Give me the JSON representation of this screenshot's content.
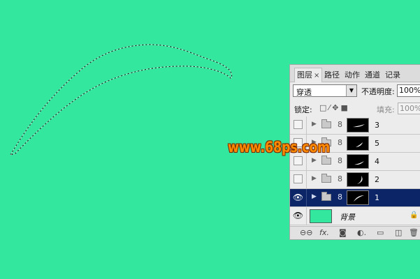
{
  "canvas": {
    "background_color": "#33e79e"
  },
  "watermark": {
    "text": "www.68ps.com",
    "color": "#ff8c00"
  },
  "panel": {
    "tabs": [
      {
        "label": "图层",
        "active": true,
        "close": "×"
      },
      {
        "label": "路径"
      },
      {
        "label": "动作"
      },
      {
        "label": "通道"
      },
      {
        "label": "记录"
      }
    ],
    "blend_mode": "穿透",
    "opacity_label": "不透明度:",
    "opacity_value": "100%",
    "lock_label": "锁定:",
    "fill_label": "填充:",
    "fill_value": "100%",
    "layers": [
      {
        "name": "3",
        "visible": false,
        "type": "group",
        "selected": false
      },
      {
        "name": "5",
        "visible": false,
        "type": "group",
        "selected": false
      },
      {
        "name": "4",
        "visible": false,
        "type": "group",
        "selected": false
      },
      {
        "name": "2",
        "visible": false,
        "type": "group",
        "selected": false
      },
      {
        "name": "1",
        "visible": true,
        "type": "group",
        "selected": true
      },
      {
        "name": "背景",
        "visible": true,
        "type": "background",
        "locked": true
      }
    ],
    "selected_color": "#0b2566",
    "bottom_icons": [
      "link-icon",
      "fx-icon",
      "mask-icon",
      "adjustment-icon",
      "group-icon",
      "new-layer-icon",
      "trash-icon"
    ]
  }
}
